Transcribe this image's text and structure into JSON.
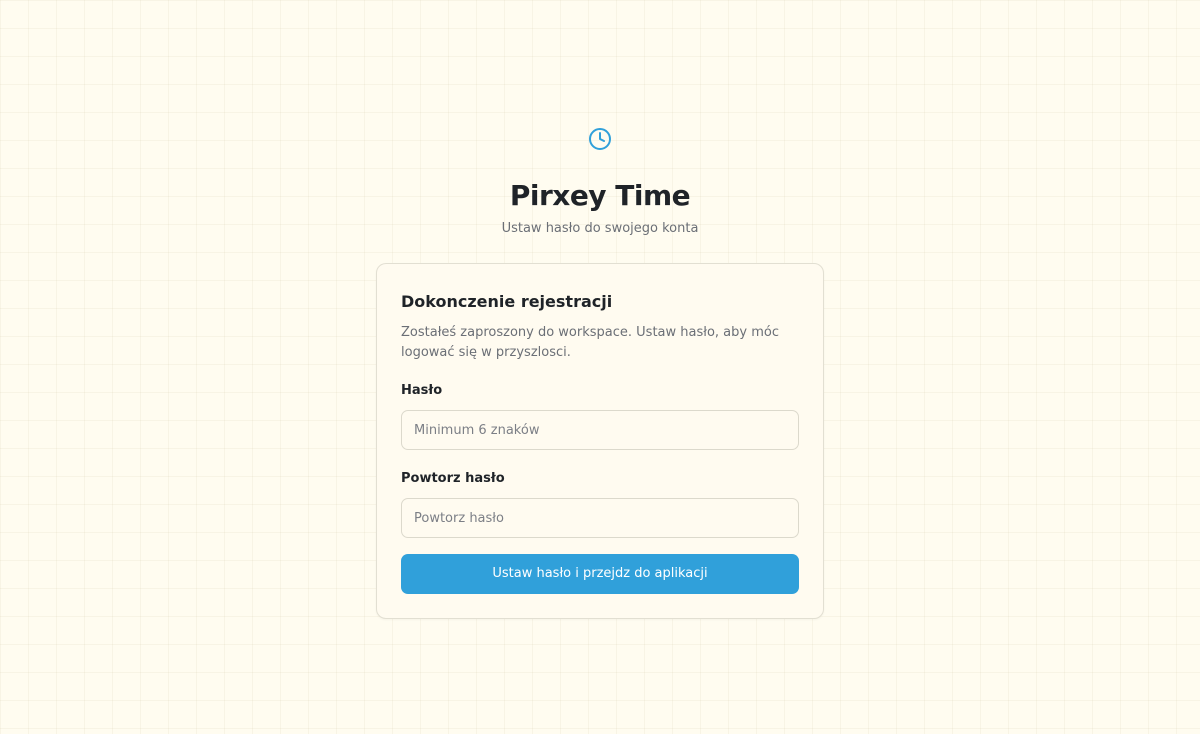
{
  "brand": {
    "icon": "clock-icon",
    "title": "Pirxey Time",
    "subtitle": "Ustaw hasło do swojego konta",
    "accent_color": "#30a0da"
  },
  "card": {
    "title": "Dokonczenie rejestracji",
    "description": "Zostałeś zaproszony do workspace. Ustaw hasło, aby móc logować się w przyszlosci.",
    "password": {
      "label": "Hasło",
      "placeholder": "Minimum 6 znaków",
      "value": ""
    },
    "repeat_password": {
      "label": "Powtorz hasło",
      "placeholder": "Powtorz hasło",
      "value": ""
    },
    "submit_label": "Ustaw hasło i przejdz do aplikacji"
  },
  "colors": {
    "background": "#fffcf0",
    "button": "#30a0da",
    "text": "#1f2328",
    "muted_text": "#6b6f76"
  }
}
